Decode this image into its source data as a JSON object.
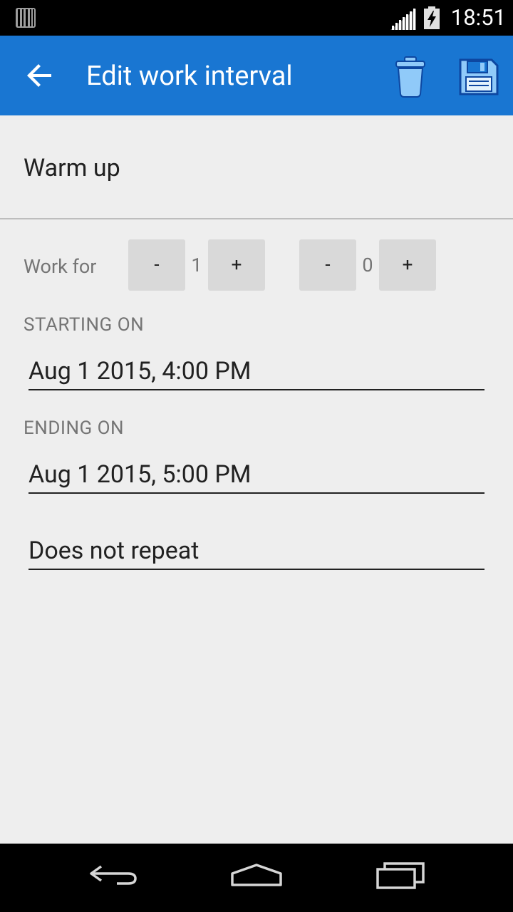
{
  "status_bar": {
    "time": "18:51",
    "icons": [
      "barcode-icon",
      "signal-icon",
      "battery-charging-icon"
    ]
  },
  "toolbar": {
    "title": "Edit work interval",
    "back_icon": "arrow-back-icon",
    "delete_icon": "trash-icon",
    "save_icon": "floppy-disk-icon",
    "color": "#1976d2",
    "accent_icon_color": "#90caf9"
  },
  "form": {
    "name": "Warm up",
    "work_for": {
      "label": "Work for",
      "hours": {
        "minus": "-",
        "value": "1",
        "plus": "+"
      },
      "minutes": {
        "minus": "-",
        "value": "0",
        "plus": "+"
      }
    },
    "starting": {
      "label": "STARTING ON",
      "value": "Aug 1 2015, 4:00 PM"
    },
    "ending": {
      "label": "ENDING ON",
      "value": "Aug 1 2015, 5:00 PM"
    },
    "repeat": {
      "value": "Does not repeat"
    }
  },
  "nav_bar": {
    "icons": [
      "back-icon",
      "home-icon",
      "recents-icon"
    ]
  }
}
